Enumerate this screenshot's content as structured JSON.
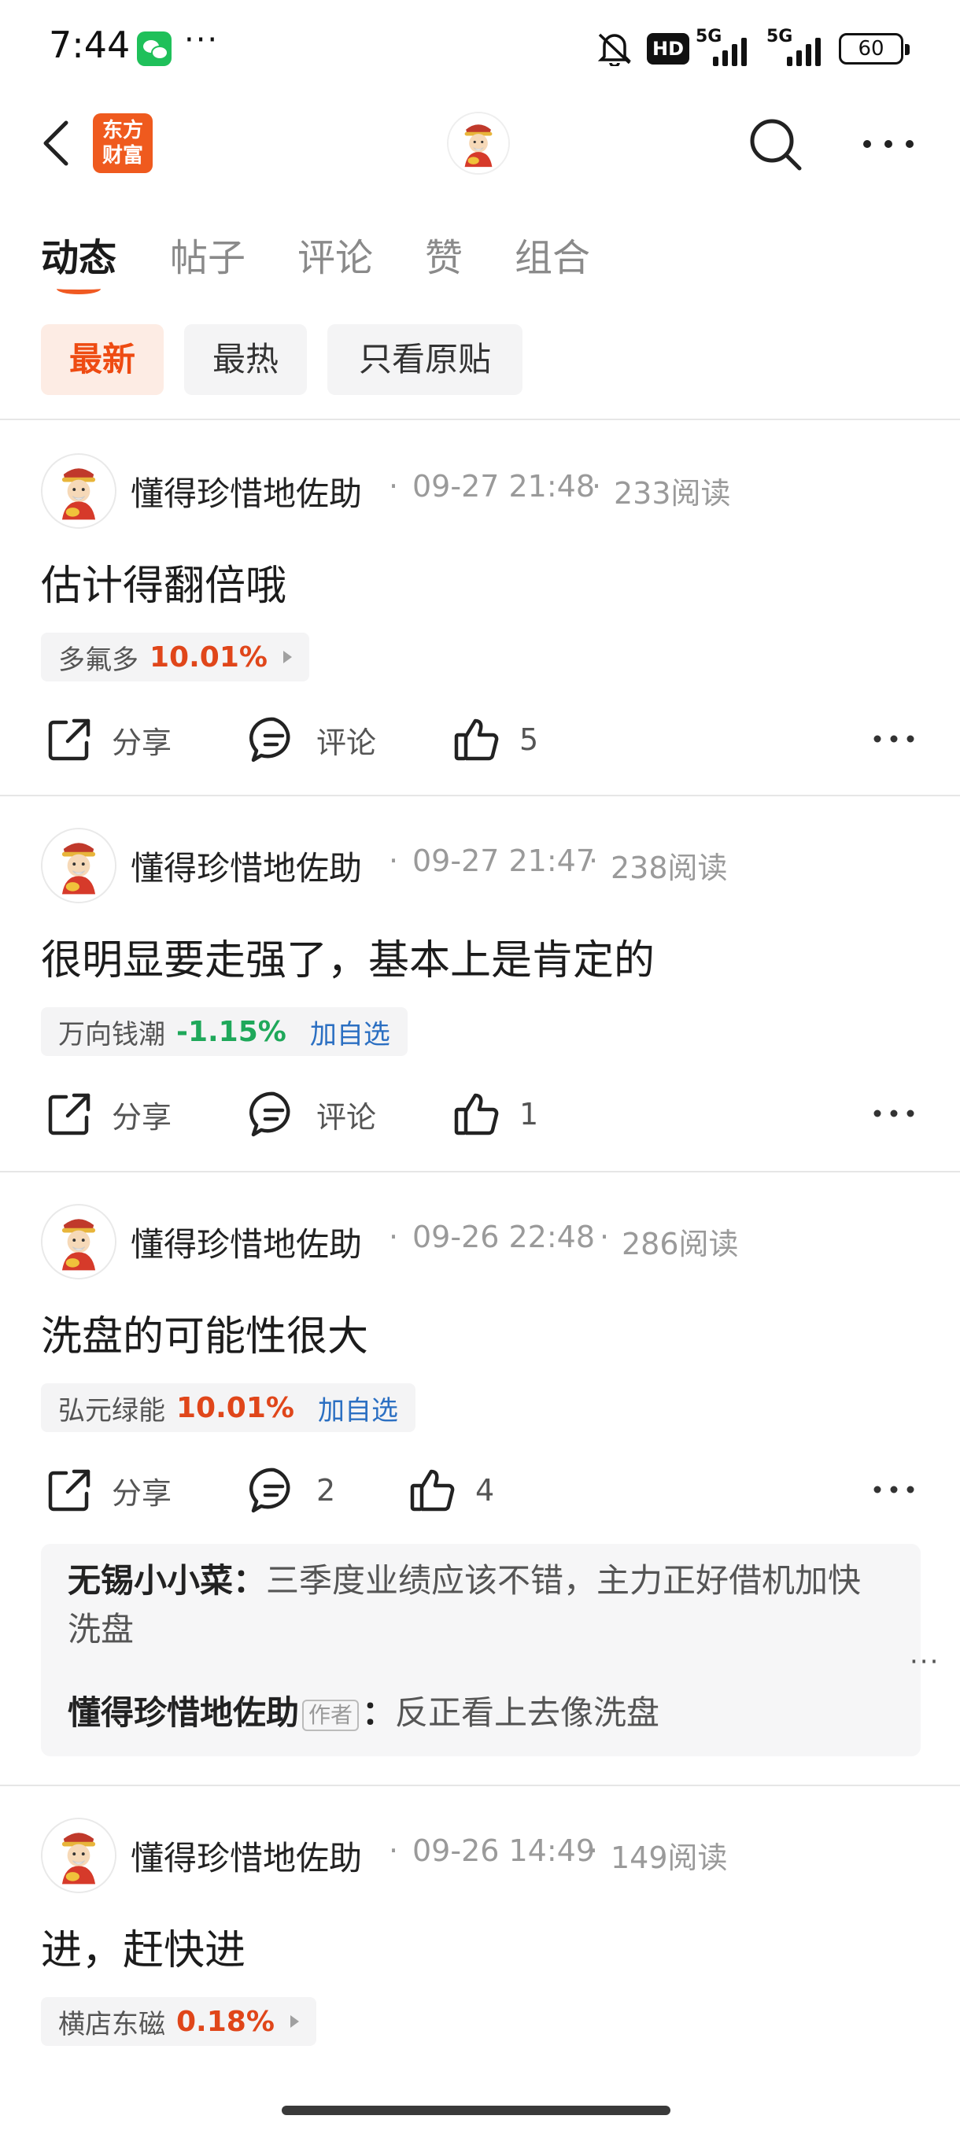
{
  "status_bar": {
    "time": "7:44",
    "dots": "···",
    "hd": "HD",
    "network_1": "5G",
    "network_2": "5G",
    "battery": "60"
  },
  "header": {
    "brand_logo_line1": "东方",
    "brand_logo_line2": "财富"
  },
  "tabs": [
    "动态",
    "帖子",
    "评论",
    "赞",
    "组合"
  ],
  "filters": [
    "最新",
    "最热",
    "只看原贴"
  ],
  "posts": [
    {
      "author": "懂得珍惜地佐助",
      "time": "09-27 21:48",
      "reads": "233阅读",
      "text": "估计得翻倍哦",
      "stock": {
        "name": "多氟多",
        "change": "10.01%",
        "direction": "up"
      },
      "actions": {
        "share": "分享",
        "comment": "评论",
        "like": "5"
      }
    },
    {
      "author": "懂得珍惜地佐助",
      "time": "09-27 21:47",
      "reads": "238阅读",
      "text": "很明显要走强了，基本上是肯定的",
      "stock": {
        "name": "万向钱潮",
        "change": "-1.15%",
        "direction": "down",
        "add_watch": "加自选"
      },
      "actions": {
        "share": "分享",
        "comment": "评论",
        "like": "1"
      }
    },
    {
      "author": "懂得珍惜地佐助",
      "time": "09-26 22:48",
      "reads": "286阅读",
      "text": "洗盘的可能性很大",
      "stock": {
        "name": "弘元绿能",
        "change": "10.01%",
        "direction": "up",
        "add_watch": "加自选"
      },
      "actions": {
        "share": "分享",
        "comment": "2",
        "like": "4"
      },
      "replies": [
        {
          "user": "无锡小小菜：",
          "text": "三季度业绩应该不错，主力正好借机加快洗盘"
        },
        {
          "user": "懂得珍惜地佐助",
          "badge": "作者",
          "separator": "：",
          "text": "反正看上去像洗盘"
        }
      ],
      "reply_more": "···"
    },
    {
      "author": "懂得珍惜地佐助",
      "time": "09-26 14:49",
      "reads": "149阅读",
      "text": "进，赶快进",
      "stock": {
        "name": "横店东磁",
        "change": "0.18%",
        "direction": "up"
      }
    }
  ],
  "meta_separator": "·",
  "colors": {
    "accent": "#ee4b12",
    "up": "#e0461a",
    "down": "#1fa85a",
    "link": "#2b6fc2"
  }
}
